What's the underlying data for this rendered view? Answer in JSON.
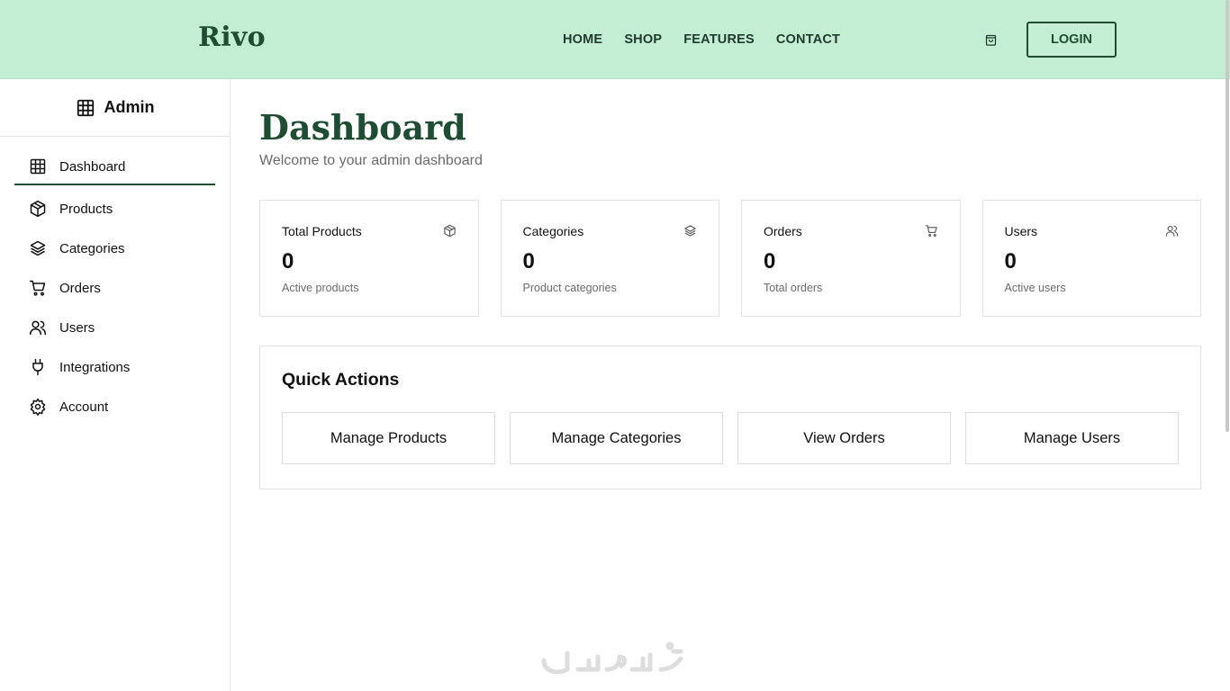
{
  "navbar": {
    "brand": "Rivo",
    "links": [
      "HOME",
      "SHOP",
      "FEATURES",
      "CONTACT"
    ],
    "login_label": "LOGIN",
    "cart_icon": "shopping-bag-icon"
  },
  "sidebar": {
    "title": "Admin",
    "title_icon": "grid-icon",
    "items": [
      {
        "label": "Dashboard",
        "icon": "grid-icon",
        "active": true
      },
      {
        "label": "Products",
        "icon": "box-icon"
      },
      {
        "label": "Categories",
        "icon": "layers-icon"
      },
      {
        "label": "Orders",
        "icon": "cart-icon"
      },
      {
        "label": "Users",
        "icon": "users-icon"
      },
      {
        "label": "Integrations",
        "icon": "plug-icon"
      },
      {
        "label": "Account",
        "icon": "gear-icon"
      }
    ]
  },
  "main": {
    "title": "Dashboard",
    "subtitle": "Welcome to your admin dashboard",
    "stats": [
      {
        "label": "Total Products",
        "value": "0",
        "desc": "Active products",
        "icon": "box-icon"
      },
      {
        "label": "Categories",
        "value": "0",
        "desc": "Product categories",
        "icon": "layers-icon"
      },
      {
        "label": "Orders",
        "value": "0",
        "desc": "Total orders",
        "icon": "cart-icon"
      },
      {
        "label": "Users",
        "value": "0",
        "desc": "Active users",
        "icon": "users-icon"
      }
    ],
    "quick_actions": {
      "title": "Quick Actions",
      "buttons": [
        "Manage Products",
        "Manage Categories",
        "View Orders",
        "Manage Users"
      ]
    }
  },
  "colors": {
    "navbar_bg": "#c3eed4",
    "brand": "#1e4d33",
    "active_underline": "#1e4d33"
  }
}
